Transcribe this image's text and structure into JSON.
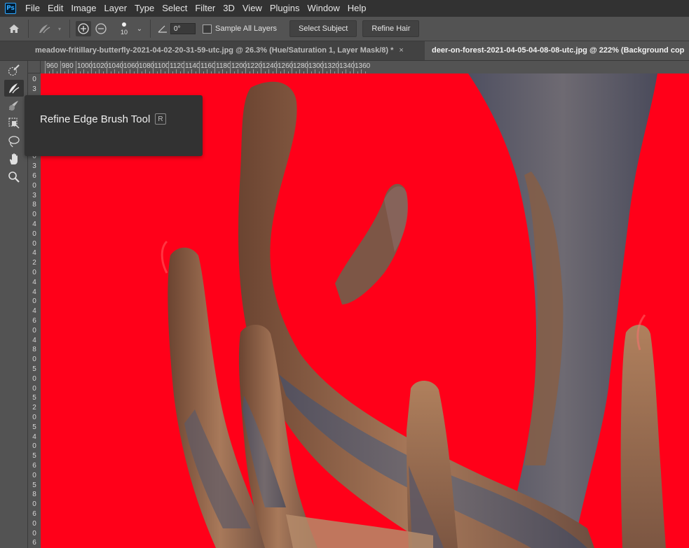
{
  "app": {
    "logo_text": "Ps"
  },
  "menu": [
    "File",
    "Edit",
    "Image",
    "Layer",
    "Type",
    "Select",
    "Filter",
    "3D",
    "View",
    "Plugins",
    "Window",
    "Help"
  ],
  "options_bar": {
    "brush_size": "10",
    "angle_value": "0°",
    "sample_all_layers_label": "Sample All Layers",
    "sample_all_layers_checked": false,
    "select_subject_label": "Select Subject",
    "refine_hair_label": "Refine Hair"
  },
  "tabs": [
    {
      "label": "meadow-fritillary-butterfly-2021-04-02-20-31-59-utc.jpg @ 26.3% (Hue/Saturation 1, Layer Mask/8) *",
      "close": "×",
      "active": false
    },
    {
      "label": "deer-on-forest-2021-04-05-04-08-08-utc.jpg @ 222% (Background cop",
      "active": true
    }
  ],
  "toolbar": {
    "collapse": "»",
    "tools": [
      {
        "name": "quick-selection-tool-icon"
      },
      {
        "name": "refine-edge-brush-icon",
        "selected": true
      },
      {
        "name": "brush-tool-icon"
      },
      {
        "name": "object-selection-icon"
      },
      {
        "name": "lasso-tool-icon"
      },
      {
        "name": "hand-tool-icon"
      },
      {
        "name": "zoom-tool-icon"
      }
    ]
  },
  "tooltip": {
    "title": "Refine Edge Brush Tool",
    "shortcut": "R"
  },
  "ruler_top": [
    "960",
    "980",
    "1000",
    "1020",
    "1040",
    "1060",
    "1080",
    "1100",
    "1120",
    "1140",
    "1160",
    "1180",
    "1200",
    "1220",
    "1240",
    "1260",
    "1280",
    "1300",
    "1320",
    "1340",
    "1360"
  ],
  "ruler_left": [
    "0",
    "3",
    "0",
    "3",
    "2",
    "0",
    "3",
    "4",
    "0",
    "3",
    "6",
    "0",
    "3",
    "8",
    "0",
    "4",
    "0",
    "0",
    "4",
    "2",
    "0",
    "4",
    "4",
    "0",
    "4",
    "6",
    "0",
    "4",
    "8",
    "0",
    "5",
    "0",
    "0",
    "5",
    "2",
    "0",
    "5",
    "4",
    "0",
    "5",
    "6",
    "0",
    "5",
    "8",
    "0",
    "6",
    "0",
    "0",
    "6"
  ],
  "colors": {
    "overlay_red": "#ff0019",
    "antler_brown": "#8a5a3c",
    "antler_grey": "#55566a"
  }
}
